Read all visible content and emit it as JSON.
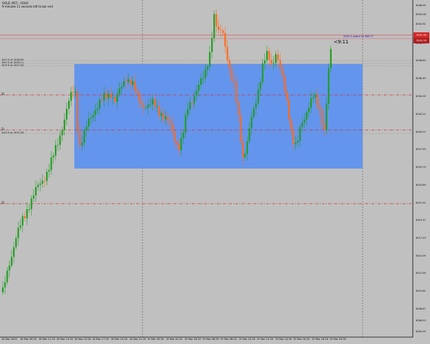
{
  "header": {
    "symbol_line": "GOLD, M15 : GOLD",
    "countdown_line": "9 minutes 11 seconds left to bar end"
  },
  "price_axis": {
    "ticks": [
      "3046.95",
      "3045.06",
      "3042.91",
      "3040.77",
      "3038.63",
      "3036.49",
      "3034.35",
      "3032.21",
      "3030.07",
      "3027.93",
      "3025.79",
      "3023.65",
      "3021.51",
      "3019.37",
      "3017.23",
      "3015.09",
      "3012.95",
      "3010.81",
      "3008.67",
      "3006.53",
      "3004.39"
    ],
    "badge_bid": "3041.40",
    "badge_ask": "3041.20"
  },
  "time_axis": {
    "ticks": [
      "18 Mar 2025",
      "18 Mar 09:30",
      "18 Mar 11:30",
      "18 Mar 13:30",
      "18 Mar 15:30",
      "18 Mar 17:30",
      "18 Mar 19:30",
      "18 Mar 21:30",
      "19 Mar 00:30",
      "19 Mar 02:30",
      "19 Mar 04:30",
      "19 Mar 06:30",
      "19 Mar 08:30",
      "19 Mar 10:30",
      "19 Mar 12:30",
      "19 Mar 14:30",
      "19 Mar 16:30",
      "19 Mar 18:30",
      "19 Mar 20:30"
    ]
  },
  "orders": [
    {
      "label": "BUY 6 at 3038.65"
    },
    {
      "label": "BUY 6 at 3038.11"
    },
    {
      "label": "BUY 6 at 3037.83"
    },
    {
      "label": "BUY 6 at 3030.38"
    }
  ],
  "levels": [
    {
      "label": "3L"
    },
    {
      "label": "2L"
    },
    {
      "label": "3L"
    }
  ],
  "countdown": "<9:11",
  "reference_label": "2025.3 select 01 383.77",
  "colors": {
    "background": "#c0c0c0",
    "bull": "#1f9e1f",
    "bear": "#ff6a1a",
    "rectangle": "#6495ed",
    "level_line": "#d22828",
    "bid_line": "#e05050"
  }
}
